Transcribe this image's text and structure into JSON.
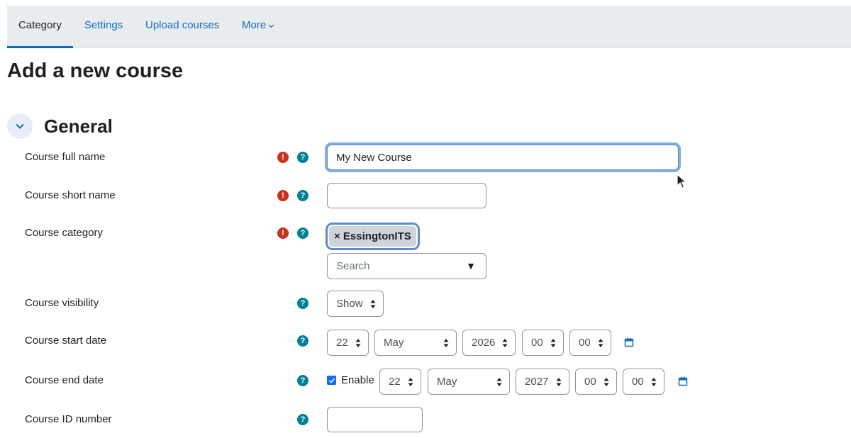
{
  "tabs": [
    {
      "label": "Category",
      "active": true
    },
    {
      "label": "Settings",
      "active": false
    },
    {
      "label": "Upload courses",
      "active": false
    },
    {
      "label": "More",
      "active": false
    }
  ],
  "page_title": "Add a new course",
  "section": {
    "title": "General",
    "expanded": true
  },
  "fields": {
    "full_name": {
      "label": "Course full name",
      "value": "My New Course",
      "required": true
    },
    "short_name": {
      "label": "Course short name",
      "value": "",
      "required": true
    },
    "category": {
      "label": "Course category",
      "selected_tag": "× EssingtonITS",
      "search_placeholder": "Search",
      "dropdown_icon": "▼",
      "required": true
    },
    "visibility": {
      "label": "Course visibility",
      "value": "Show"
    },
    "start_date": {
      "label": "Course start date",
      "day": "22",
      "month": "May",
      "year": "2026",
      "hour": "00",
      "minute": "00"
    },
    "end_date": {
      "label": "Course end date",
      "enable_label": "Enable",
      "enabled": true,
      "day": "22",
      "month": "May",
      "year": "2027",
      "hour": "00",
      "minute": "00"
    },
    "id_number": {
      "label": "Course ID number",
      "value": ""
    }
  },
  "icons": {
    "required": "!",
    "help": "?",
    "required_color": "#ca3120",
    "help_color": "#008196",
    "accent_color": "#0f6cbf"
  }
}
